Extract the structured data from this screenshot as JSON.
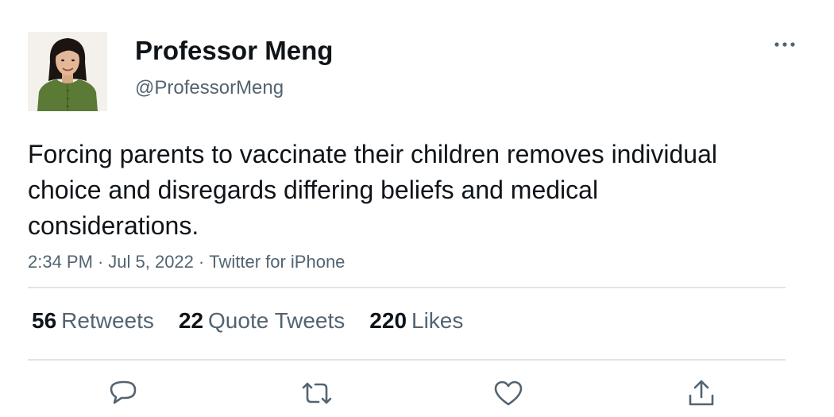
{
  "tweet": {
    "author": {
      "display_name": "Professor Meng",
      "handle": "@ProfessorMeng"
    },
    "text": "Forcing parents to vaccinate their children removes individual choice and disregards differing beliefs and medical considerations.",
    "time": "2:34 PM",
    "date": "Jul 5, 2022",
    "source": "Twitter for iPhone",
    "separator": "·",
    "stats": {
      "retweets_count": "56",
      "retweets_label": "Retweets",
      "quote_tweets_count": "22",
      "quote_tweets_label": "Quote Tweets",
      "likes_count": "220",
      "likes_label": "Likes"
    }
  },
  "icons": {
    "more": "more-horizontal-icon",
    "reply": "reply-icon",
    "retweet": "retweet-icon",
    "like": "heart-icon",
    "share": "share-icon"
  },
  "colors": {
    "text_primary": "#0f1419",
    "text_secondary": "#536471",
    "icon": "#536471",
    "divider": "#e1e4e6"
  }
}
